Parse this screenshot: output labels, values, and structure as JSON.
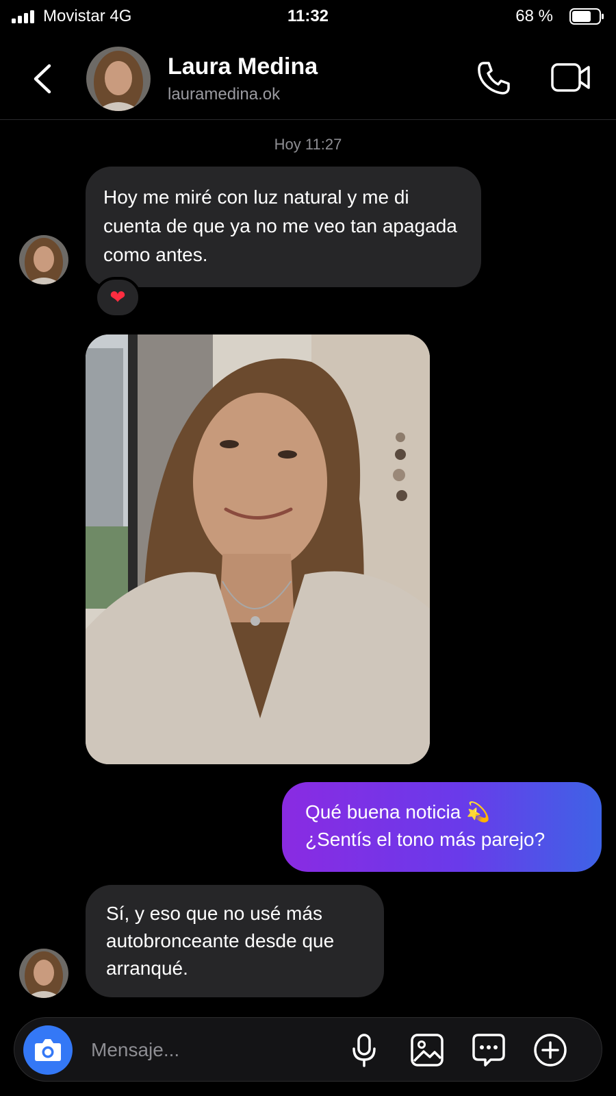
{
  "status_bar": {
    "carrier": "Movistar  4G",
    "time": "11:32",
    "battery": "68 %"
  },
  "header": {
    "name": "Laura Medina",
    "username": "lauramedina.ok"
  },
  "thread": {
    "timestamp": "Hoy 11:27",
    "msg1": "Hoy me miré con luz natural y me di cuenta de que ya no me veo tan apagada como antes.",
    "reaction": "❤",
    "outgoing_line1": "Qué buena noticia 💫",
    "outgoing_line2": "¿Sentís el tono más parejo?",
    "msg3": "Sí, y eso que no usé más autobronceante desde que arranqué."
  },
  "composer": {
    "placeholder": "Mensaje..."
  },
  "colors": {
    "accent": "#3478f6",
    "outgoing_start": "#8a2be2",
    "outgoing_end": "#3e63e6",
    "incoming_bubble": "#262628"
  },
  "icons": [
    "signal-icon",
    "battery-icon",
    "back-icon",
    "phone-icon",
    "video-icon",
    "camera-icon",
    "microphone-icon",
    "gallery-icon",
    "sticker-icon",
    "add-icon",
    "heart-icon"
  ]
}
